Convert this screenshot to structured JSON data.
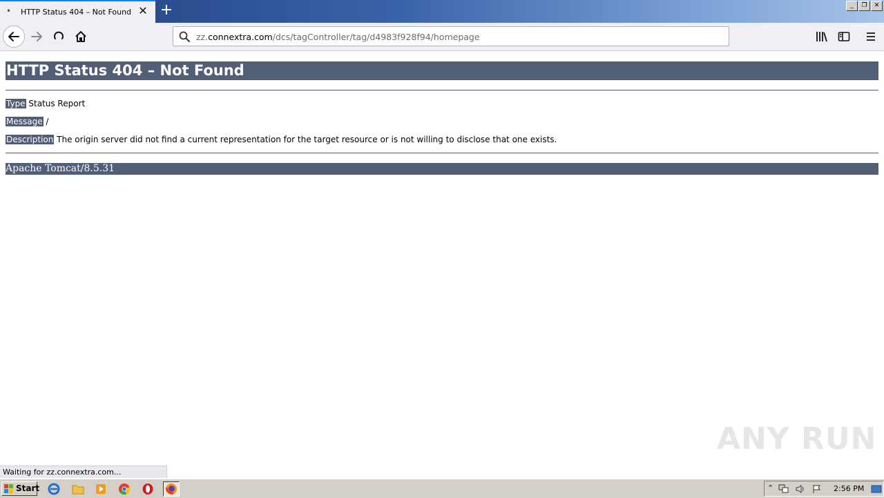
{
  "browser": {
    "tab": {
      "title": "HTTP Status 404 – Not Found",
      "close_glyph": "✕"
    },
    "new_tab_glyph": "+",
    "url": {
      "host": "zz.connextra.com",
      "path": "/dcs/tagController/tag/d4983f928f94/homepage",
      "prefix": "zz.",
      "domain": "connextra.com"
    },
    "status_text": "Waiting for zz.connextra.com..."
  },
  "page": {
    "heading": "HTTP Status 404 – Not Found",
    "type_label": "Type",
    "type_value": " Status Report",
    "message_label": "Message",
    "message_value": " /",
    "description_label": "Description",
    "description_value": " The origin server did not find a current representation for the target resource or is not willing to disclose that one exists.",
    "footer": "Apache Tomcat/8.5.31"
  },
  "watermark": "ANY RUN",
  "taskbar": {
    "start_label": "Start",
    "clock": "2:56 PM"
  },
  "colors": {
    "tomcat_bar": "#525d76",
    "accent": "#0a84ff"
  }
}
